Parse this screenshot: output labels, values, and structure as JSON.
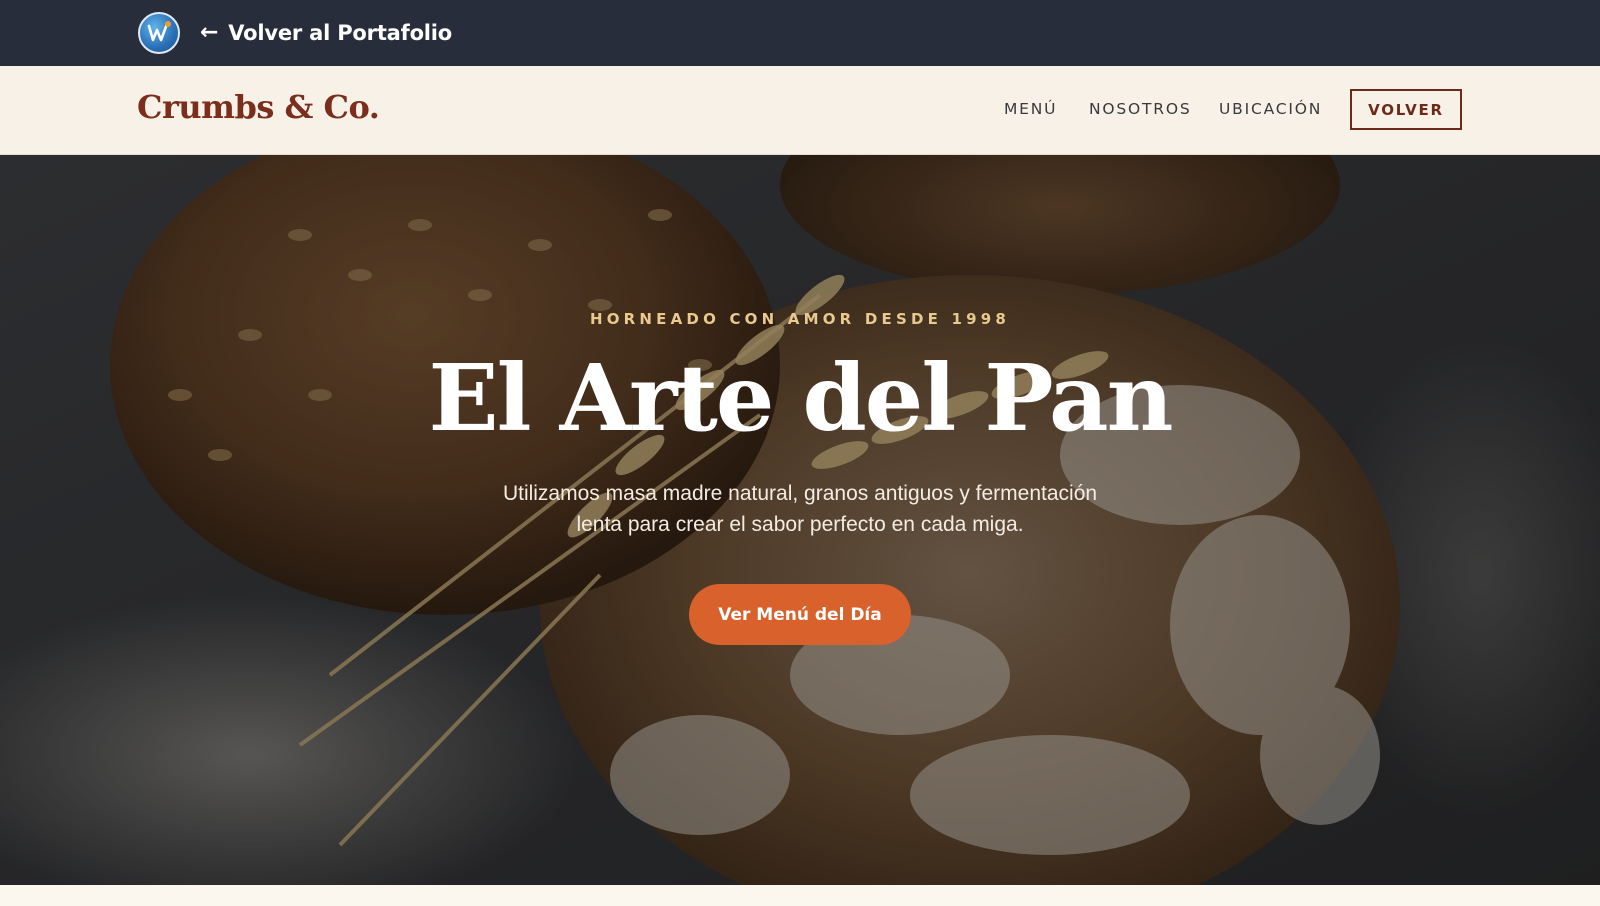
{
  "topbar": {
    "logo_icon": "portfolio-logo-icon",
    "back_arrow": "←",
    "back_label": "Volver al Portafolio"
  },
  "header": {
    "brand": "Crumbs & Co.",
    "nav": [
      {
        "label": "MENÚ"
      },
      {
        "label": "NOSOTROS"
      },
      {
        "label": "UBICACIÓN"
      }
    ],
    "cta_label": "VOLVER"
  },
  "hero": {
    "eyebrow": "HORNEADO CON AMOR DESDE 1998",
    "title": "El Arte del Pan",
    "subtitle": "Utilizamos masa madre natural, granos antiguos y fermentación lenta para crear el sabor perfecto en cada miga.",
    "button_label": "Ver Menú del Día",
    "background_image": "bread-loaves-wheat-photo"
  },
  "colors": {
    "topbar_bg": "#282d3c",
    "header_bg": "#f7f1e8",
    "brand": "#7a2e1b",
    "eyebrow": "#e9c98f",
    "cta_bg": "#d9612c",
    "outline_button": "#6e2a19"
  }
}
